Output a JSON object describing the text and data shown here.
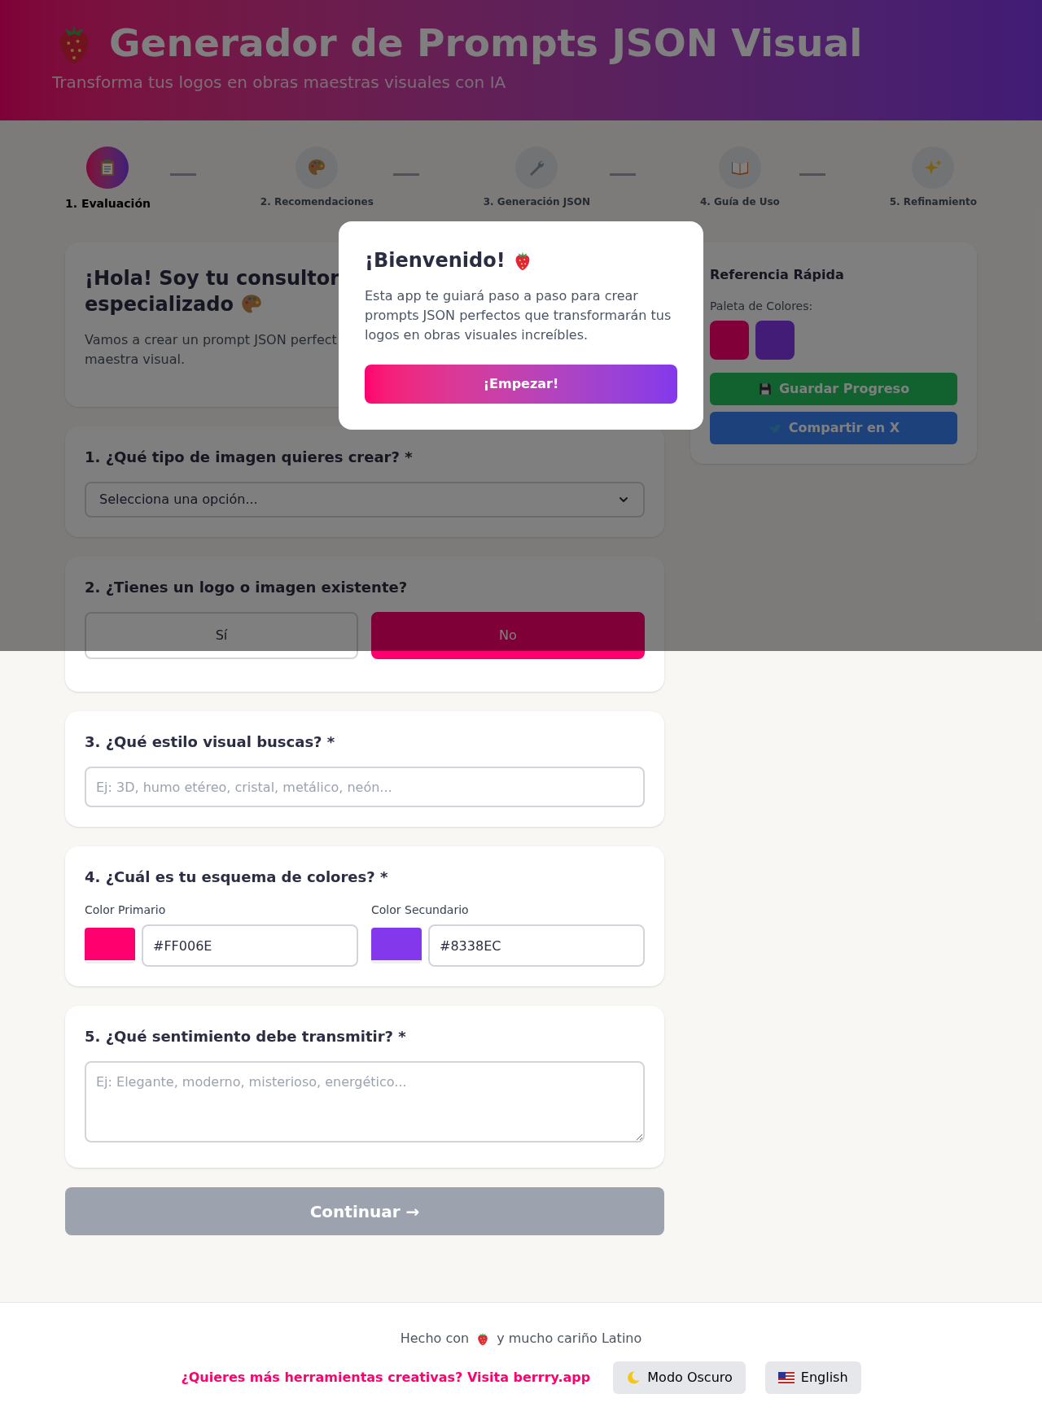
{
  "header": {
    "title": "Generador de Prompts JSON Visual",
    "subtitle": "Transforma tus logos en obras maestras visuales con IA"
  },
  "steps": [
    {
      "label": "1. Evaluación",
      "selected": true
    },
    {
      "label": "2. Recomendaciones",
      "selected": false
    },
    {
      "label": "3. Generación JSON",
      "selected": false
    },
    {
      "label": "4. Guía de Uso",
      "selected": false
    },
    {
      "label": "5. Refinamiento",
      "selected": false
    }
  ],
  "intro": {
    "title_lines": [
      "¡Hola! Soy tu consultor",
      "especializado"
    ],
    "text_lines": [
      "Vamos a crear un prompt JSON perfect",
      "maestra visual."
    ]
  },
  "questions": [
    {
      "kind": "select",
      "title": "1. ¿Qué tipo de imagen quieres crear? *",
      "value": "Selecciona una opción..."
    },
    {
      "kind": "choice",
      "title": "2. ¿Tienes un logo o imagen existente?",
      "options": [
        {
          "label": "Sí",
          "selected": false
        },
        {
          "label": "No",
          "selected": true
        }
      ]
    },
    {
      "kind": "text",
      "title": "3. ¿Qué estilo visual buscas? *",
      "placeholder": "Ej: 3D, humo etéreo, cristal, metálico, neón..."
    },
    {
      "kind": "colors",
      "title": "4. ¿Cuál es tu esquema de colores? *",
      "fields": [
        {
          "label": "Color Primario",
          "color": "#ff006e",
          "value": "#FF006E"
        },
        {
          "label": "Color Secundario",
          "color": "#8338ec",
          "value": "#8338EC"
        }
      ]
    },
    {
      "kind": "textarea",
      "title": "5. ¿Qué sentimiento debe transmitir? *",
      "placeholder": "Ej: Elegante, moderno, misterioso, energético..."
    }
  ],
  "continue_button": {
    "label": "Continuar →",
    "disabled": true
  },
  "sidebar": {
    "title": "Referencia Rápida",
    "palette_label": "Paleta de Colores:",
    "palette": [
      {
        "color": "#800037"
      },
      {
        "color": "#421c76"
      }
    ],
    "buttons": [
      {
        "kind": "save",
        "label": "Guardar Progreso"
      },
      {
        "kind": "share",
        "label": "Compartir en X"
      }
    ]
  },
  "modal": {
    "title": "¡Bienvenido!",
    "text": "Esta app te guiará paso a paso para crear prompts JSON perfectos que transformarán tus logos en obras visuales increíbles.",
    "button": "¡Empezar!"
  },
  "footer": {
    "credit_before": "Hecho con",
    "credit_after": "y mucho cariño Latino",
    "link": "¿Quieres más herramientas creativas? Visita berrry.app",
    "buttons": [
      {
        "kind": "dark_mode",
        "label": "Modo Oscuro"
      },
      {
        "kind": "language",
        "label": "English"
      }
    ]
  }
}
